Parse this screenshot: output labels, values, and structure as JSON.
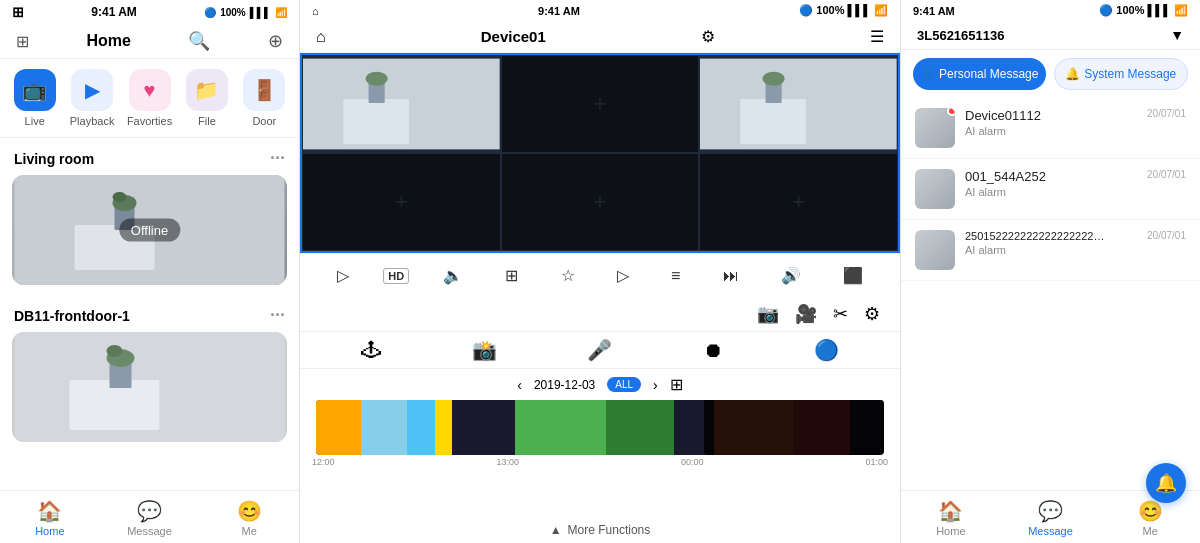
{
  "panel1": {
    "statusBar": {
      "time": "9:41 AM",
      "battery": "100%",
      "signal": "●●●●"
    },
    "navTitle": "Home",
    "quickActions": [
      {
        "id": "live",
        "label": "Live",
        "icon": "📺",
        "colorClass": "blue"
      },
      {
        "id": "playback",
        "label": "Playback",
        "icon": "▶",
        "colorClass": "light-blue"
      },
      {
        "id": "favorties",
        "label": "Favorties",
        "icon": "♥",
        "colorClass": "pink"
      },
      {
        "id": "file",
        "label": "File",
        "icon": "📁",
        "colorClass": "purple-bg"
      },
      {
        "id": "door",
        "label": "Door",
        "icon": "🚪",
        "colorClass": "light-blue"
      }
    ],
    "sections": [
      {
        "title": "Living room",
        "device": {
          "status": "Offline"
        }
      },
      {
        "title": "DB11-frontdoor-1",
        "device": {
          "status": "online"
        }
      }
    ],
    "bottomTabs": [
      {
        "id": "home",
        "label": "Home",
        "icon": "🏠",
        "active": true
      },
      {
        "id": "message",
        "label": "Message",
        "icon": "💬",
        "active": false
      },
      {
        "id": "me",
        "label": "Me",
        "icon": "😊",
        "active": false
      }
    ]
  },
  "panel2": {
    "statusBar": {
      "time": "9:41 AM",
      "battery": "100%"
    },
    "navTitle": "Device01",
    "videoGrid": {
      "cells": [
        {
          "hasFeed": true
        },
        {
          "hasFeed": false
        },
        {
          "hasFeed": true
        },
        {
          "hasFeed": false
        },
        {
          "hasFeed": false
        },
        {
          "hasFeed": false
        }
      ]
    },
    "controls": [
      {
        "id": "play",
        "icon": "▷",
        "label": "play"
      },
      {
        "id": "hd",
        "icon": "HD",
        "label": "hd"
      },
      {
        "id": "volume",
        "icon": "🔈",
        "label": "volume"
      },
      {
        "id": "layout4",
        "icon": "⊞",
        "label": "layout"
      },
      {
        "id": "star",
        "icon": "☆",
        "label": "favorite"
      },
      {
        "id": "play2",
        "icon": "▷",
        "label": "play2"
      },
      {
        "id": "list",
        "icon": "≡",
        "label": "list"
      },
      {
        "id": "skip",
        "icon": "▷▷",
        "label": "skip"
      },
      {
        "id": "vol2",
        "icon": "🔊",
        "label": "vol2"
      },
      {
        "id": "pip",
        "icon": "⬛",
        "label": "pip"
      }
    ],
    "playbackIcons": [
      {
        "id": "camera",
        "icon": "📷"
      },
      {
        "id": "video",
        "icon": "🎥"
      },
      {
        "id": "cut",
        "icon": "✂"
      },
      {
        "id": "settings",
        "icon": "⚙"
      }
    ],
    "bottomIcons": [
      {
        "id": "joystick",
        "icon": "🕹"
      },
      {
        "id": "snapshot",
        "icon": "📸"
      },
      {
        "id": "mic",
        "icon": "🎤"
      },
      {
        "id": "record",
        "icon": "⏺"
      },
      {
        "id": "fisheye",
        "icon": "🔵"
      }
    ],
    "timeline": {
      "date": "2019-12-03",
      "label": "ALL",
      "segments": [
        {
          "color": "#FFA500",
          "left": "0%",
          "width": "8%"
        },
        {
          "color": "#87CEEB",
          "left": "8%",
          "width": "12%"
        },
        {
          "color": "#4FC3F7",
          "left": "20%",
          "width": "5%"
        },
        {
          "color": "#FFD700",
          "left": "25%",
          "width": "4%"
        },
        {
          "color": "#4CAF50",
          "left": "35%",
          "width": "18%"
        },
        {
          "color": "#2E7D32",
          "left": "53%",
          "width": "12%"
        },
        {
          "color": "#FF5722",
          "left": "72%",
          "width": "15%"
        },
        {
          "color": "#E53935",
          "left": "87%",
          "width": "10%"
        }
      ],
      "timeLabels": [
        "12:00",
        "13:00",
        "00:00",
        "01:00"
      ]
    },
    "moreFunctions": "More Functions"
  },
  "panel3": {
    "statusBar": {
      "time": "9:41 AM",
      "battery": "100%"
    },
    "navTitle": "3L5621651136",
    "filterIcon": "▼",
    "tabs": [
      {
        "id": "personal",
        "label": "Personal Message",
        "active": true
      },
      {
        "id": "system",
        "label": "System Message",
        "active": false
      }
    ],
    "messages": [
      {
        "id": "msg1",
        "title": "Device01112",
        "subtitle": "AI alarm",
        "time": "20/07/01",
        "hasNotification": true
      },
      {
        "id": "msg2",
        "title": "001_544A252",
        "subtitle": "AI alarm",
        "time": "20/07/01",
        "hasNotification": false
      },
      {
        "id": "msg3",
        "title": "25015222222222222222222",
        "subtitle": "AI alarm",
        "time": "20/07/01",
        "hasNotification": false
      }
    ],
    "bottomTabs": [
      {
        "id": "home",
        "label": "Home",
        "icon": "🏠",
        "active": false
      },
      {
        "id": "message",
        "label": "Message",
        "icon": "💬",
        "active": true
      },
      {
        "id": "me",
        "label": "Me",
        "icon": "😊",
        "active": false
      }
    ],
    "fab": {
      "icon": "🔔"
    }
  }
}
